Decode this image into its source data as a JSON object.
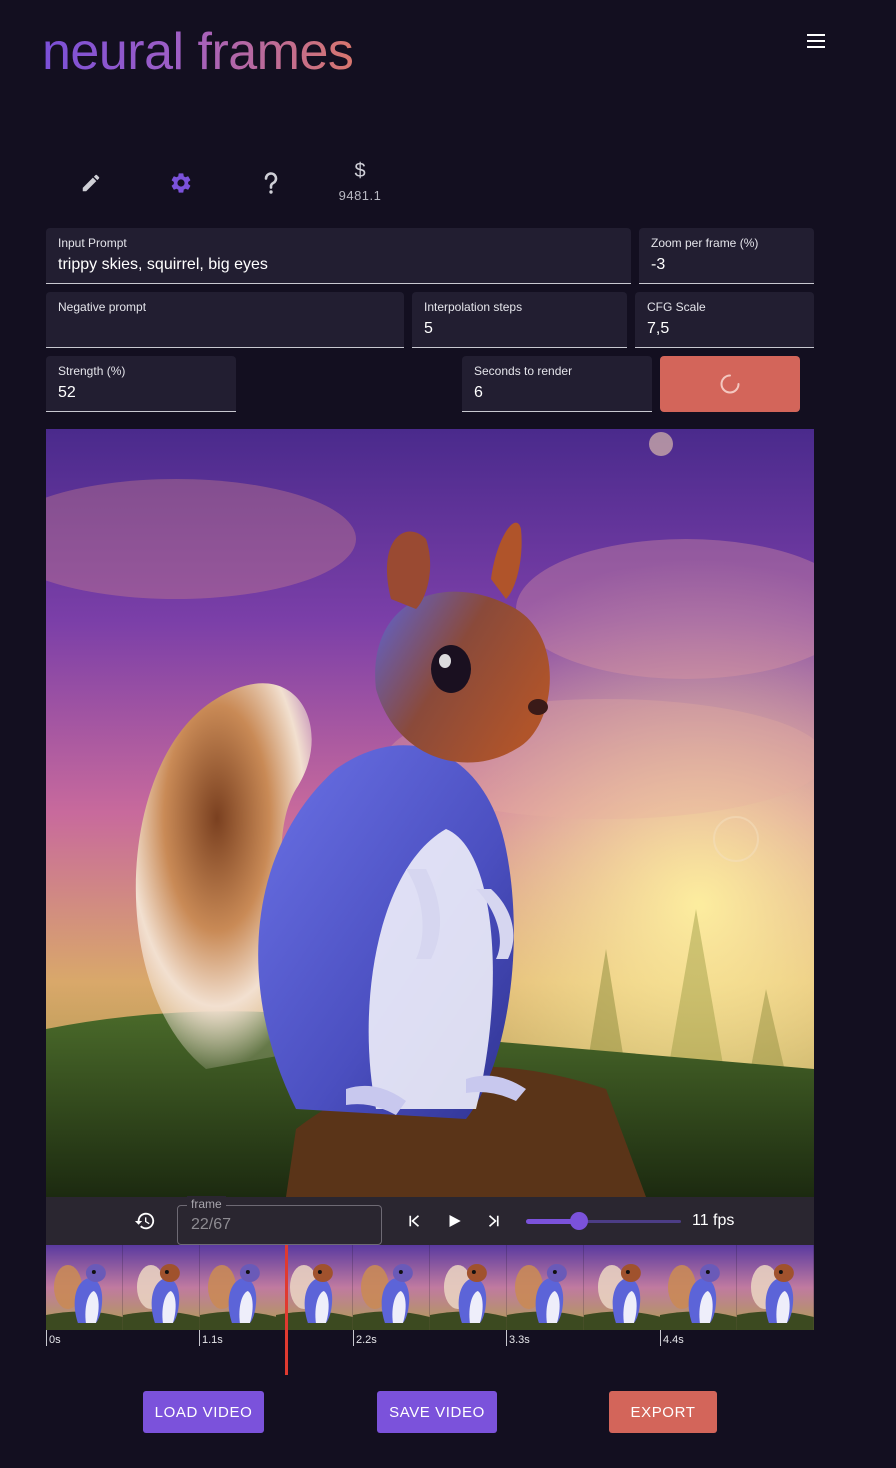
{
  "app": {
    "title": "neural frames"
  },
  "toolbar": {
    "credits_symbol": "$",
    "credits_value": "9481.1"
  },
  "fields": {
    "input_prompt": {
      "label": "Input Prompt",
      "value": "trippy skies, squirrel, big eyes"
    },
    "zoom_per_frame": {
      "label": "Zoom per frame (%)",
      "value": "-3"
    },
    "negative_prompt": {
      "label": "Negative prompt",
      "value": ""
    },
    "interpolation_steps": {
      "label": "Interpolation steps",
      "value": "5"
    },
    "cfg_scale": {
      "label": "CFG Scale",
      "value": "7,5"
    },
    "strength": {
      "label": "Strength (%)",
      "value": "52"
    },
    "seconds_to_render": {
      "label": "Seconds to render",
      "value": "6"
    }
  },
  "player": {
    "frame_label": "frame",
    "frame_value": "22/67",
    "fps_value": 11,
    "fps_label": "11 fps"
  },
  "timeline": {
    "ticks": [
      "0s",
      "1.1s",
      "2.2s",
      "3.3s",
      "4.4s"
    ],
    "thumbnail_count": 10
  },
  "buttons": {
    "load_video": "LOAD VIDEO",
    "save_video": "SAVE VIDEO",
    "export": "EXPORT"
  },
  "colors": {
    "background": "#130f20",
    "accent_purple": "#7b52db",
    "accent_coral": "#d3655a",
    "playhead": "#e03a30"
  }
}
